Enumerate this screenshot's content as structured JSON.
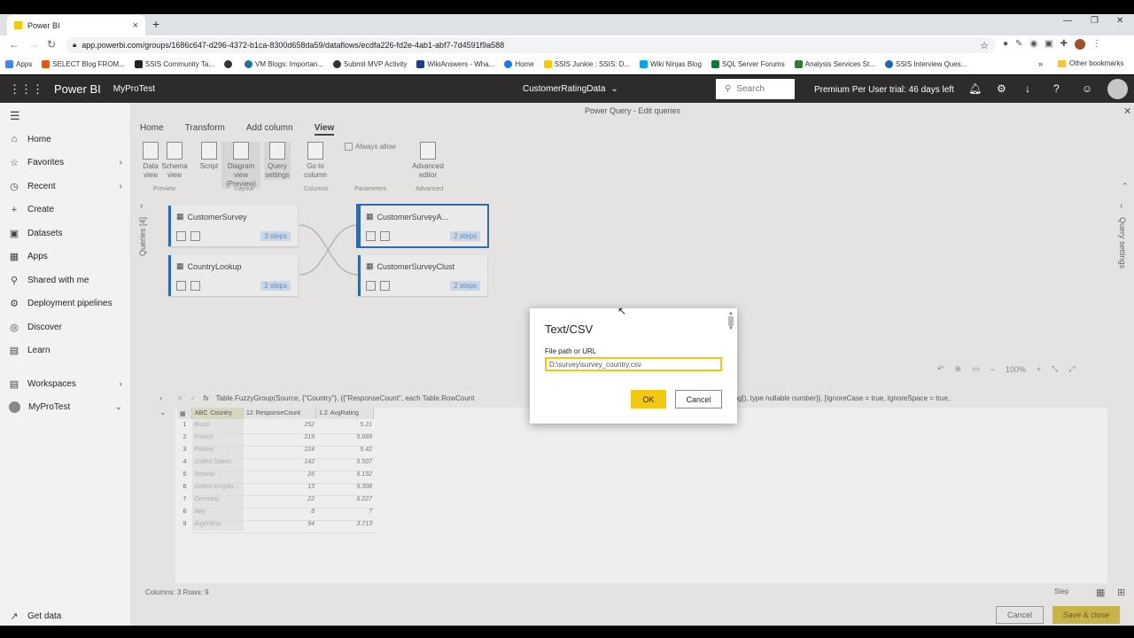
{
  "browser": {
    "tab_title": "Power BI",
    "url": "app.powerbi.com/groups/1686c647-d296-4372-b1ca-8300d658da59/dataflows/ecdfa226-fd2e-4ab1-abf7-7d4591f9a588",
    "bookmarks": [
      "Apps",
      "SELECT Blog FROM...",
      "SSIS Community Ta...",
      "",
      "VM Blogs: Importan...",
      "Submit MVP Activity",
      "WikiAnswers - Wha...",
      "Home",
      "SSIS Junkie : SSIS: D...",
      "Wiki Ninjas Blog",
      "SQL Server Forums",
      "Analysis Services St...",
      "SSIS Interview Ques..."
    ],
    "other_bookmarks": "Other bookmarks",
    "overflow": "»"
  },
  "header": {
    "app_name": "Power BI",
    "workspace": "MyProTest",
    "dataflow": "CustomerRatingData",
    "search_placeholder": "Search",
    "trial": "Premium Per User trial: 46 days left"
  },
  "nav": {
    "items": [
      {
        "label": "Home",
        "icon": "⌂"
      },
      {
        "label": "Favorites",
        "icon": "☆",
        "chev": "›"
      },
      {
        "label": "Recent",
        "icon": "◷",
        "chev": "›"
      },
      {
        "label": "Create",
        "icon": "+"
      },
      {
        "label": "Datasets",
        "icon": "▣"
      },
      {
        "label": "Apps",
        "icon": "▦"
      },
      {
        "label": "Shared with me",
        "icon": "⚲"
      },
      {
        "label": "Deployment pipelines",
        "icon": "⚙"
      },
      {
        "label": "Discover",
        "icon": "◎"
      },
      {
        "label": "Learn",
        "icon": "▤"
      }
    ],
    "workspaces": "Workspaces",
    "current_ws": "MyProTest",
    "get_data": "Get data"
  },
  "pq": {
    "title": "Power Query - Edit queries",
    "tabs": [
      "Home",
      "Transform",
      "Add column",
      "View"
    ],
    "ribbon": [
      {
        "label": "Data view"
      },
      {
        "label": "Schema view"
      },
      {
        "label": "Script"
      },
      {
        "label": "Diagram view (Preview)"
      },
      {
        "label": "Query settings"
      },
      {
        "label": "Go to column"
      },
      {
        "label": "Advanced editor"
      }
    ],
    "always_allow": "Always allow",
    "groups": [
      "Preview",
      "Layout",
      "Columns",
      "Parameters",
      "Advanced"
    ],
    "queries_label": "Queries [4]",
    "query_settings_label": "Query settings",
    "cards": [
      {
        "name": "CustomerSurvey",
        "steps": "3 steps"
      },
      {
        "name": "CountryLookup",
        "steps": "2 steps"
      },
      {
        "name": "CustomerSurveyA...",
        "steps": "2 steps"
      },
      {
        "name": "CustomerSurveyClust",
        "steps": "2 steps"
      }
    ],
    "zoom": "100%",
    "formula": "Table.FuzzyGroup(Source, {\"Country\"}, {{\"ResponseCount\", each Table.RowCount",
    "formula_end": "ating]), type nullable number}}, [IgnoreCase = true, IgnoreSpace = true,",
    "columns": [
      "Country",
      "ResponseCount",
      "AvgRating"
    ],
    "column_types": [
      "ABC",
      "12",
      "1.2"
    ],
    "rows": [
      [
        "Brazil",
        "252",
        "5.21"
      ],
      [
        "France",
        "219",
        "5.689"
      ],
      [
        "Poland",
        "224",
        "5.42"
      ],
      [
        "United States",
        "142",
        "5.507"
      ],
      [
        "Norway",
        "26",
        "6.192"
      ],
      [
        "United Kingdo...",
        "13",
        "5.308"
      ],
      [
        "Germany",
        "22",
        "6.227"
      ],
      [
        "Italy",
        "8",
        "7"
      ],
      [
        "Argentina",
        "94",
        "3.713"
      ]
    ],
    "status": "Columns: 3   Rows: 9",
    "step_label": "Step",
    "cancel": "Cancel",
    "save_close": "Save & close"
  },
  "dialog": {
    "title": "Text/CSV",
    "label": "File path or URL",
    "value": "D:\\survey\\survey_country.csv",
    "ok": "OK",
    "cancel": "Cancel"
  },
  "colors": {
    "accent": "#f2c811",
    "header": "#2d2c2b"
  }
}
